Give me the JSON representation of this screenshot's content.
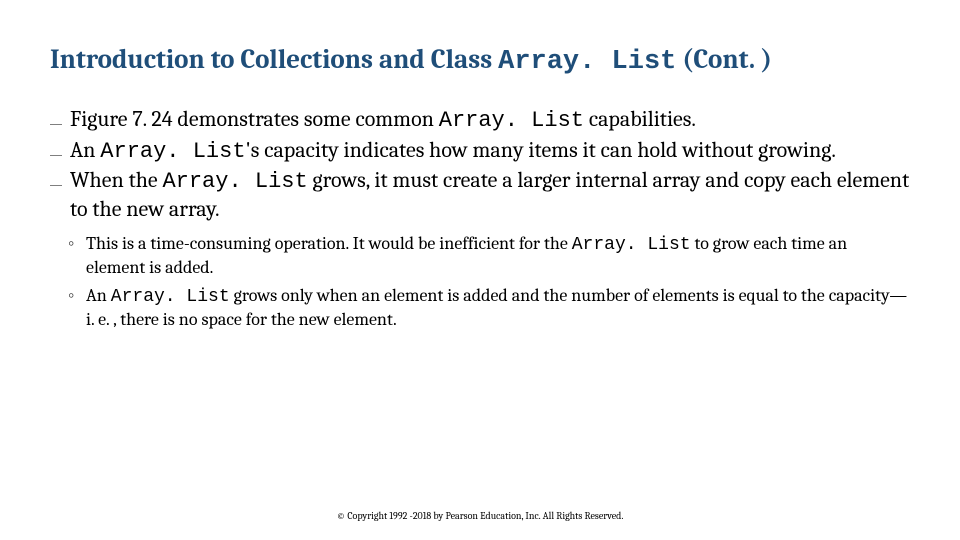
{
  "title": {
    "prefix": "Introduction to Collections and Class ",
    "code": "Array. List",
    "suffix": " (Cont. )"
  },
  "bullets": [
    {
      "pre": "Figure 7. 24 demonstrates some common ",
      "code": "Array. List",
      "post": " capabilities."
    },
    {
      "pre": "An ",
      "code": "Array. List",
      "post": "'s capacity indicates how many items it can hold without growing."
    },
    {
      "pre": "When the ",
      "code": "Array. List",
      "post": " grows, it must create a larger internal array and copy each element to the new array."
    }
  ],
  "sub_bullets": [
    {
      "pre": "This is a time-consuming operation. It would be inefficient for the ",
      "code": "Array. List",
      "post": " to grow each time an element is added."
    },
    {
      "pre": "An ",
      "code": "Array. List",
      "post": " grows only when an element is added and the number of elements is equal to the capacity—i. e. , there is no space for the new element."
    }
  ],
  "footer": "© Copyright 1992 -2018 by Pearson Education, Inc. All Rights Reserved."
}
